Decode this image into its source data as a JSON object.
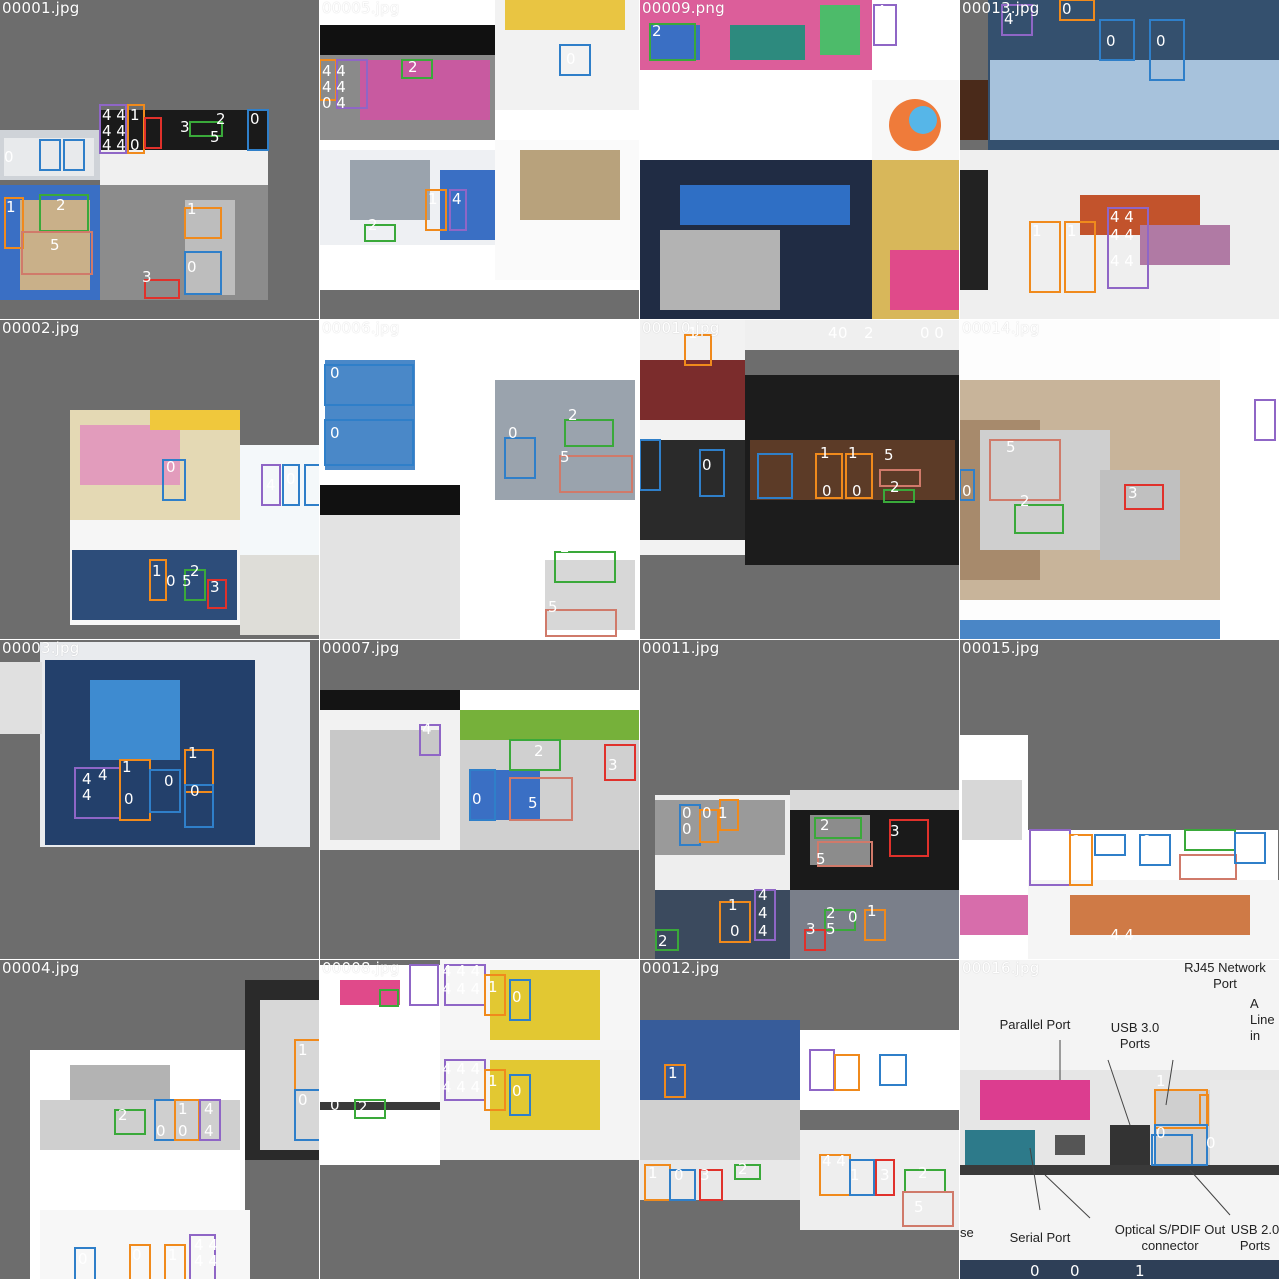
{
  "tiles": [
    {
      "file": "00001.jpg"
    },
    {
      "file": "00005.jpg"
    },
    {
      "file": "00009.png"
    },
    {
      "file": "00013.jpg"
    },
    {
      "file": "00002.jpg"
    },
    {
      "file": "00006.jpg"
    },
    {
      "file": "00010.jpg"
    },
    {
      "file": "00014.jpg"
    },
    {
      "file": "00003.jpg"
    },
    {
      "file": "00007.jpg"
    },
    {
      "file": "00011.jpg"
    },
    {
      "file": "00015.jpg"
    },
    {
      "file": "00004.jpg"
    },
    {
      "file": "00008.jpg"
    },
    {
      "file": "00012.jpg"
    },
    {
      "file": "00016.jpg"
    }
  ],
  "tile16_captions": {
    "rj45": "RJ45 Network Port",
    "parallel": "Parallel Port",
    "usb3": "USB 3.0 Ports",
    "audio": "A Line in",
    "serial": "Serial Port",
    "optical": "Optical S/PDIF Out connector",
    "usb2": "USB 2.0 Ports",
    "se": "se"
  },
  "colors": {
    "usb": "#2f7fc9",
    "rj45": "#f08a1c",
    "vga": "#3aa93a",
    "hdmi": "#e0312b",
    "dvi": "#d07a6a",
    "audio": "#8f66c6",
    "background": "#6d6d6d"
  }
}
